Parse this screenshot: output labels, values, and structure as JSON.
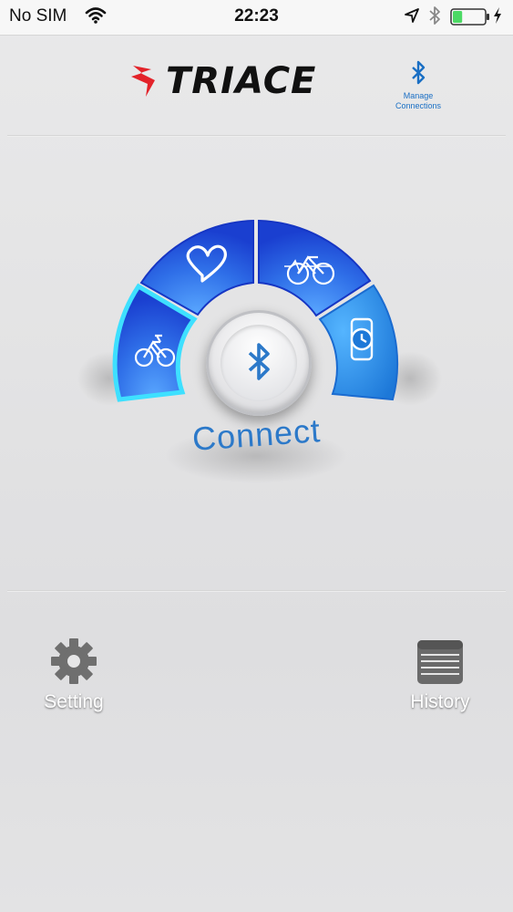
{
  "status_bar": {
    "carrier": "No SIM",
    "time": "22:23",
    "icons": [
      "wifi-icon",
      "location-icon",
      "bluetooth-icon",
      "battery-icon",
      "charging-icon"
    ],
    "battery_level": 0.3
  },
  "header": {
    "brand": "TRIACE",
    "manage_connections_line1": "Manage",
    "manage_connections_line2": "Connections",
    "manage_icon": "bluetooth-icon"
  },
  "dial": {
    "segments": [
      {
        "name": "bike",
        "icon": "bicycle-icon",
        "active": true
      },
      {
        "name": "heart",
        "icon": "heart-icon",
        "active": false
      },
      {
        "name": "tandem",
        "icon": "bicycle-heartrate-icon",
        "active": false
      },
      {
        "name": "watch",
        "icon": "watch-icon",
        "active": false
      }
    ],
    "center_icon": "bluetooth-icon",
    "connect_label": "Connect"
  },
  "footer": {
    "setting_label": "Setting",
    "history_label": "History"
  },
  "colors": {
    "dial_blue": "#1f4fe0",
    "dial_light_blue": "#2f8be0",
    "active_glow": "#36d6ff",
    "accent_text": "#2c79c9",
    "brand_red": "#e3232a"
  }
}
